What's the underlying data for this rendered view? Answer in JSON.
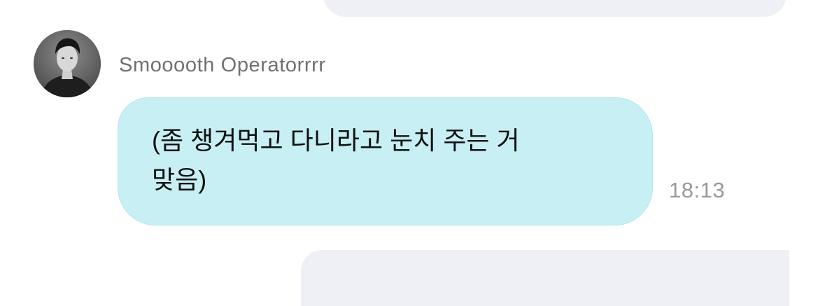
{
  "message": {
    "sender_name": "Smooooth Operatorrrr",
    "text": "(좀 챙겨먹고 다니라고 눈치 주는 거\n맞음)",
    "time": "18:13",
    "bubble_color": "#c8f0f4",
    "avatar_icon": "profile-photo"
  },
  "thread": {
    "other_bubble_color": "#eff0f5"
  }
}
